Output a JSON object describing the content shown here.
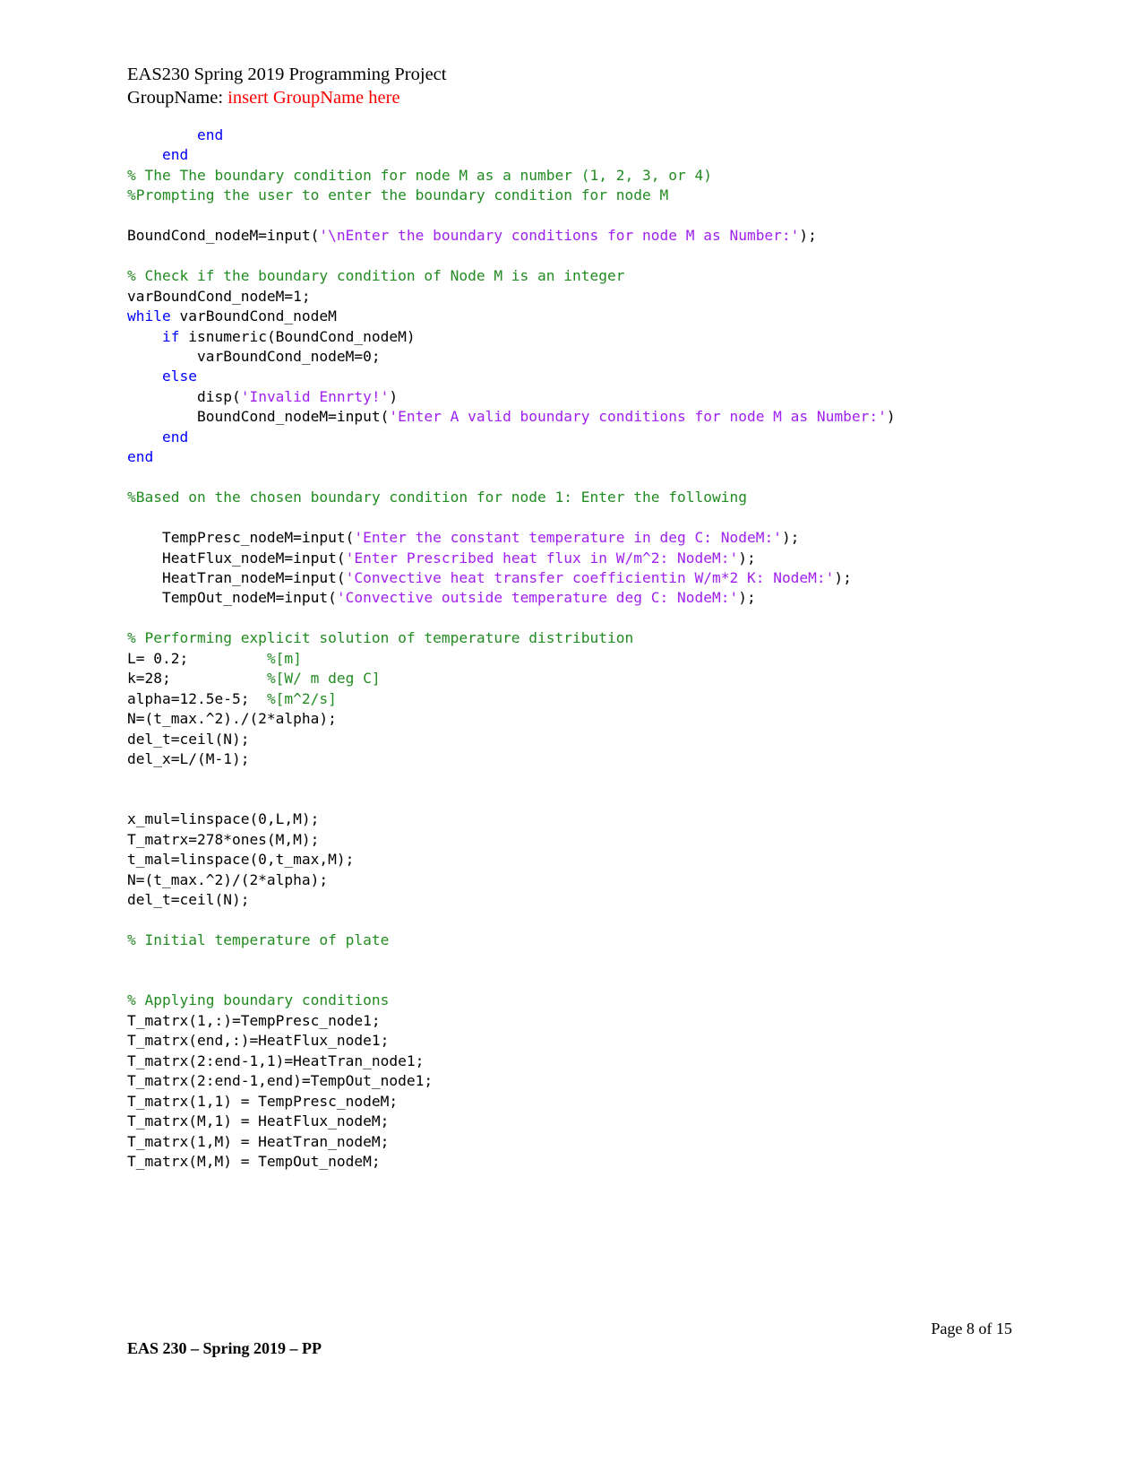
{
  "header": {
    "title_line": "EAS230 Spring 2019 Programming Project",
    "group_label": "GroupName:",
    "group_placeholder": "insert GroupName here",
    "accent_color": "#ff0000"
  },
  "syntax_colors": {
    "keyword": "#0000ff",
    "comment": "#228b22",
    "string": "#a020f0",
    "plain": "#000000"
  },
  "code": {
    "language": "MATLAB",
    "lines": [
      [
        {
          "t": "plain",
          "s": "        "
        },
        {
          "t": "keyword",
          "s": "end"
        }
      ],
      [
        {
          "t": "plain",
          "s": "    "
        },
        {
          "t": "keyword",
          "s": "end"
        }
      ],
      [
        {
          "t": "comment",
          "s": "% The The boundary condition for node M as a number (1, 2, 3, or 4)"
        }
      ],
      [
        {
          "t": "comment",
          "s": "%Prompting the user to enter the boundary condition for node M"
        }
      ],
      [
        {
          "t": "plain",
          "s": ""
        }
      ],
      [
        {
          "t": "plain",
          "s": "BoundCond_nodeM=input("
        },
        {
          "t": "string",
          "s": "'\\nEnter the boundary conditions for node M as Number:'"
        },
        {
          "t": "plain",
          "s": ");"
        }
      ],
      [
        {
          "t": "plain",
          "s": ""
        }
      ],
      [
        {
          "t": "comment",
          "s": "% Check if the boundary condition of Node M is an integer"
        }
      ],
      [
        {
          "t": "plain",
          "s": "varBoundCond_nodeM=1;"
        }
      ],
      [
        {
          "t": "keyword",
          "s": "while"
        },
        {
          "t": "plain",
          "s": " varBoundCond_nodeM"
        }
      ],
      [
        {
          "t": "plain",
          "s": "    "
        },
        {
          "t": "keyword",
          "s": "if"
        },
        {
          "t": "plain",
          "s": " isnumeric(BoundCond_nodeM)"
        }
      ],
      [
        {
          "t": "plain",
          "s": "        varBoundCond_nodeM=0;"
        }
      ],
      [
        {
          "t": "plain",
          "s": "    "
        },
        {
          "t": "keyword",
          "s": "else"
        }
      ],
      [
        {
          "t": "plain",
          "s": "        disp("
        },
        {
          "t": "string",
          "s": "'Invalid Ennrty!'"
        },
        {
          "t": "plain",
          "s": ")"
        }
      ],
      [
        {
          "t": "plain",
          "s": "        BoundCond_nodeM=input("
        },
        {
          "t": "string",
          "s": "'Enter A valid boundary conditions for node M as Number:'"
        },
        {
          "t": "plain",
          "s": ")"
        }
      ],
      [
        {
          "t": "plain",
          "s": "    "
        },
        {
          "t": "keyword",
          "s": "end"
        }
      ],
      [
        {
          "t": "keyword",
          "s": "end"
        }
      ],
      [
        {
          "t": "plain",
          "s": ""
        }
      ],
      [
        {
          "t": "comment",
          "s": "%Based on the chosen boundary condition for node 1: Enter the following"
        }
      ],
      [
        {
          "t": "plain",
          "s": ""
        }
      ],
      [
        {
          "t": "plain",
          "s": "    TempPresc_nodeM=input("
        },
        {
          "t": "string",
          "s": "'Enter the constant temperature in deg C: NodeM:'"
        },
        {
          "t": "plain",
          "s": ");"
        }
      ],
      [
        {
          "t": "plain",
          "s": "    HeatFlux_nodeM=input("
        },
        {
          "t": "string",
          "s": "'Enter Prescribed heat flux in W/m^2: NodeM:'"
        },
        {
          "t": "plain",
          "s": ");"
        }
      ],
      [
        {
          "t": "plain",
          "s": "    HeatTran_nodeM=input("
        },
        {
          "t": "string",
          "s": "'Convective heat transfer coefficientin W/m*2 K: NodeM:'"
        },
        {
          "t": "plain",
          "s": ");"
        }
      ],
      [
        {
          "t": "plain",
          "s": "    TempOut_nodeM=input("
        },
        {
          "t": "string",
          "s": "'Convective outside temperature deg C: NodeM:'"
        },
        {
          "t": "plain",
          "s": ");"
        }
      ],
      [
        {
          "t": "plain",
          "s": ""
        }
      ],
      [
        {
          "t": "comment",
          "s": "% Performing explicit solution of temperature distribution"
        }
      ],
      [
        {
          "t": "plain",
          "s": "L= 0.2;         "
        },
        {
          "t": "comment",
          "s": "%[m]"
        }
      ],
      [
        {
          "t": "plain",
          "s": "k=28;           "
        },
        {
          "t": "comment",
          "s": "%[W/ m deg C]"
        }
      ],
      [
        {
          "t": "plain",
          "s": "alpha=12.5e-5;  "
        },
        {
          "t": "comment",
          "s": "%[m^2/s]"
        }
      ],
      [
        {
          "t": "plain",
          "s": "N=(t_max.^2)./(2*alpha);"
        }
      ],
      [
        {
          "t": "plain",
          "s": "del_t=ceil(N);"
        }
      ],
      [
        {
          "t": "plain",
          "s": "del_x=L/(M-1);"
        }
      ],
      [
        {
          "t": "plain",
          "s": ""
        }
      ],
      [
        {
          "t": "plain",
          "s": ""
        }
      ],
      [
        {
          "t": "plain",
          "s": "x_mul=linspace(0,L,M);"
        }
      ],
      [
        {
          "t": "plain",
          "s": "T_matrx=278*ones(M,M);"
        }
      ],
      [
        {
          "t": "plain",
          "s": "t_mal=linspace(0,t_max,M);"
        }
      ],
      [
        {
          "t": "plain",
          "s": "N=(t_max.^2)/(2*alpha);"
        }
      ],
      [
        {
          "t": "plain",
          "s": "del_t=ceil(N);"
        }
      ],
      [
        {
          "t": "plain",
          "s": ""
        }
      ],
      [
        {
          "t": "comment",
          "s": "% Initial temperature of plate"
        }
      ],
      [
        {
          "t": "plain",
          "s": ""
        }
      ],
      [
        {
          "t": "plain",
          "s": ""
        }
      ],
      [
        {
          "t": "comment",
          "s": "% Applying boundary conditions"
        }
      ],
      [
        {
          "t": "plain",
          "s": "T_matrx(1,:)=TempPresc_node1;"
        }
      ],
      [
        {
          "t": "plain",
          "s": "T_matrx(end,:)=HeatFlux_node1;"
        }
      ],
      [
        {
          "t": "plain",
          "s": "T_matrx(2:end-1,1)=HeatTran_node1;"
        }
      ],
      [
        {
          "t": "plain",
          "s": "T_matrx(2:end-1,end)=TempOut_node1;"
        }
      ],
      [
        {
          "t": "plain",
          "s": "T_matrx(1,1) = TempPresc_nodeM;"
        }
      ],
      [
        {
          "t": "plain",
          "s": "T_matrx(M,1) = HeatFlux_nodeM;"
        }
      ],
      [
        {
          "t": "plain",
          "s": "T_matrx(1,M) = HeatTran_nodeM;"
        }
      ],
      [
        {
          "t": "plain",
          "s": "T_matrx(M,M) = TempOut_nodeM;"
        }
      ]
    ]
  },
  "footer": {
    "page_number": "Page 8 of 15",
    "course_line": "EAS 230 – Spring 2019 – PP"
  }
}
